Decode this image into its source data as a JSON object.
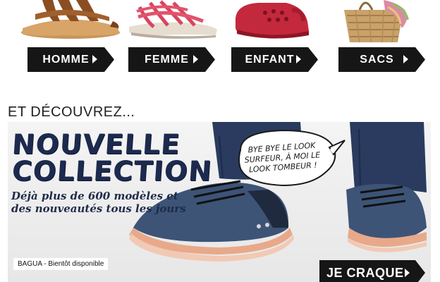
{
  "categories": [
    {
      "label": "HOMME",
      "image": "brown-leather-sandal"
    },
    {
      "label": "FEMME",
      "image": "pink-strappy-sandal"
    },
    {
      "label": "ENFANT",
      "image": "red-clog"
    },
    {
      "label": "SACS",
      "image": "straw-basket-bag"
    }
  ],
  "section_title": "ET DÉCOUVREZ...",
  "banner": {
    "title_line1": "NOUVELLE",
    "title_line2": "COLLECTION",
    "subtitle": "Déjà plus de 600 modèles et des nouveautés tous les jours",
    "speech_bubble": "BYE BYE LE LOOK SURFEUR, À MOI LE LOOK TOMBEUR !",
    "caption": "BAGUA - Bientôt disponible",
    "cta_label": "JE CRAQUE"
  },
  "colors": {
    "button_bg": "#161616",
    "button_text": "#ffffff",
    "title_navy": "#1c2a4e",
    "denim": "#3d5477",
    "sole": "#e8a98a"
  }
}
